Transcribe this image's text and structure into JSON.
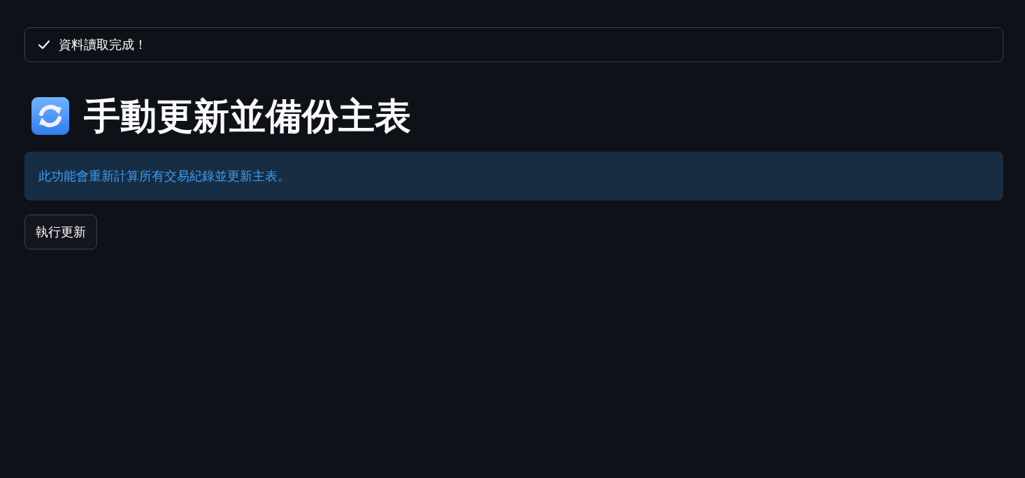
{
  "toast": {
    "text": "資料讀取完成！"
  },
  "header": {
    "title": "手動更新並備份主表"
  },
  "info": {
    "text": "此功能會重新計算所有交易紀錄並更新主表。"
  },
  "button": {
    "label": "執行更新"
  }
}
